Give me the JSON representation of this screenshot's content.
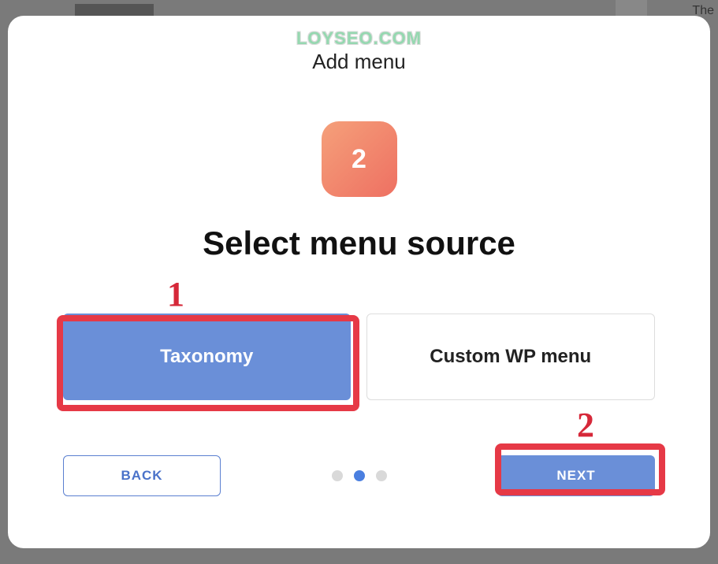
{
  "watermark": "LOYSEO.COM",
  "modal": {
    "title": "Add menu",
    "step_number": "2",
    "heading": "Select menu source",
    "options": [
      {
        "label": "Taxonomy",
        "selected": true
      },
      {
        "label": "Custom WP menu",
        "selected": false
      }
    ],
    "back_label": "BACK",
    "next_label": "NEXT",
    "step_indicator": {
      "total": 3,
      "current": 2
    }
  },
  "annotations": [
    {
      "label": "1"
    },
    {
      "label": "2"
    }
  ],
  "background": {
    "text_fragment": "The"
  }
}
